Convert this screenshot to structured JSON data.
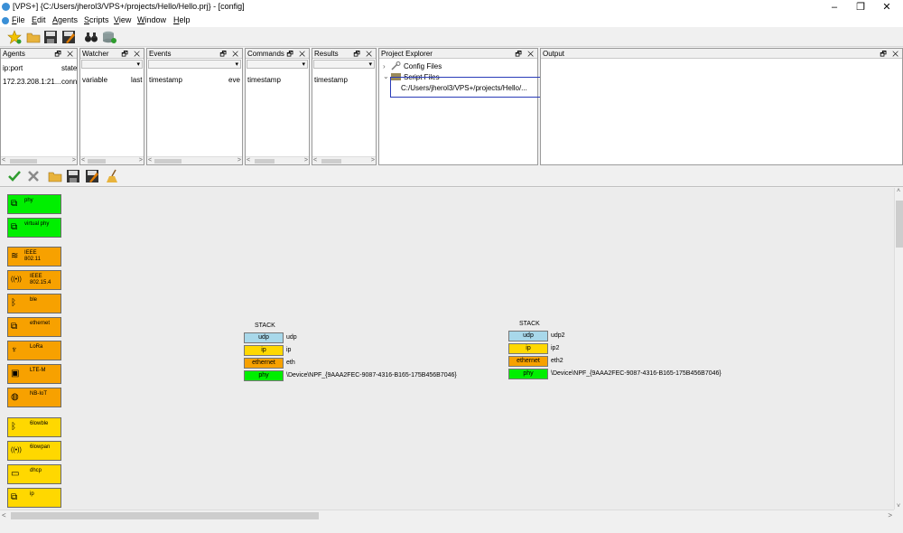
{
  "window": {
    "title": "[VPS+] {C:/Users/jherol3/VPS+/projects/Hello/Hello.prj} - [config]",
    "min": "–",
    "max": "❐",
    "close": "✕"
  },
  "menu": [
    {
      "key": "F",
      "rest": "ile"
    },
    {
      "key": "E",
      "rest": "dit"
    },
    {
      "key": "A",
      "rest": "gents"
    },
    {
      "key": "S",
      "rest": "cripts"
    },
    {
      "key": "V",
      "rest": "iew"
    },
    {
      "key": "W",
      "rest": "indow"
    },
    {
      "key": "H",
      "rest": "elp"
    }
  ],
  "panels": {
    "agents": {
      "title": "Agents",
      "col1": "ip:port",
      "col2": "state",
      "row_ip": "172.23.208.1:21...",
      "row_state": "conn"
    },
    "watcher": {
      "title": "Watcher",
      "col1": "variable",
      "col2": "last"
    },
    "events": {
      "title": "Events",
      "col1": "timestamp",
      "col2": "eve"
    },
    "commands": {
      "title": "Commands",
      "col1": "timestamp"
    },
    "results": {
      "title": "Results",
      "col1": "timestamp"
    },
    "project": {
      "title": "Project Explorer",
      "config_files": "Config Files",
      "script_files": "Script Files",
      "script_path": "C:/Users/jherol3/VPS+/projects/Hello/..."
    },
    "output": {
      "title": "Output"
    },
    "ctrl": "🗗 ✕"
  },
  "palette": [
    {
      "label": "phy",
      "color": "green",
      "glyph": "⧉"
    },
    {
      "label": "virtual phy",
      "color": "green",
      "glyph": "⧉"
    },
    {
      "label": "IEEE 802.11",
      "color": "orange",
      "glyph": "≋"
    },
    {
      "label": "IEEE 802.15.4",
      "color": "orange",
      "glyph": "((•))"
    },
    {
      "label": "ble",
      "color": "orange",
      "glyph": "ᛒ"
    },
    {
      "label": "ethernet",
      "color": "orange",
      "glyph": "⧉"
    },
    {
      "label": "LoRa",
      "color": "orange",
      "glyph": "♆"
    },
    {
      "label": "LTE-M",
      "color": "orange",
      "glyph": "▣"
    },
    {
      "label": "NB-IoT",
      "color": "orange",
      "glyph": "◍"
    },
    {
      "label": "6lowble",
      "color": "yellow",
      "glyph": "ᛒ"
    },
    {
      "label": "6lowpan",
      "color": "yellow",
      "glyph": "((•))"
    },
    {
      "label": "dhcp",
      "color": "yellow",
      "glyph": "▭"
    },
    {
      "label": "ip",
      "color": "yellow",
      "glyph": "⧉"
    }
  ],
  "stacks": [
    {
      "title": "STACK",
      "layers": [
        {
          "type": "udp",
          "name": "udp"
        },
        {
          "type": "ip",
          "name": "ip"
        },
        {
          "type": "ethernet",
          "name": "eth"
        },
        {
          "type": "phy",
          "name": "\\Device\\NPF_{9AAA2FEC-9087-4316-B165-175B456B7046}"
        }
      ]
    },
    {
      "title": "STACK",
      "layers": [
        {
          "type": "udp",
          "name": "udp2"
        },
        {
          "type": "ip",
          "name": "ip2"
        },
        {
          "type": "ethernet",
          "name": "eth2"
        },
        {
          "type": "phy",
          "name": "\\Device\\NPF_{9AAA2FEC-9087-4316-B165-175B456B7046}"
        }
      ]
    }
  ],
  "icons": {
    "toolbar1": [
      "star-icon",
      "open-folder-icon",
      "save-icon",
      "save-as-icon",
      "binoculars-icon",
      "database-add-icon"
    ],
    "toolbar2": [
      "check-icon",
      "cross-icon",
      "open-folder-icon",
      "save-icon",
      "save-as-icon",
      "broom-icon"
    ]
  },
  "colors": {
    "phy": "#00ef00",
    "ethernet": "#f7a100",
    "ip": "#ffd800",
    "udp": "#a8d8ea",
    "selection": "#2a3cb8"
  }
}
